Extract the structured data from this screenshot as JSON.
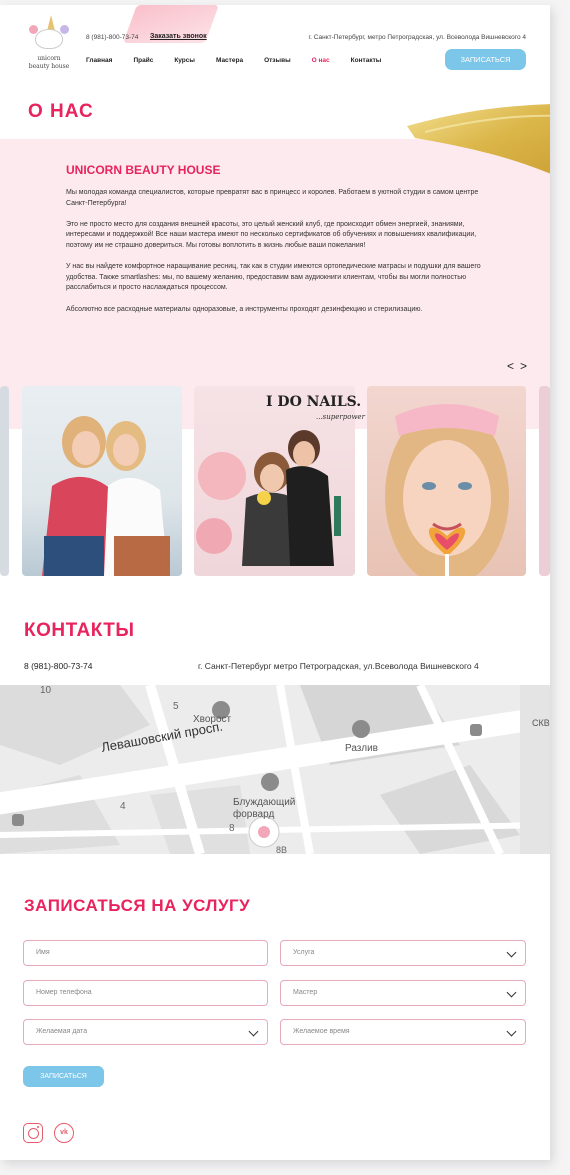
{
  "header": {
    "logo": {
      "line1": "unicorn",
      "line2": "beauty house"
    },
    "phone": "8 (981)-800-73-74",
    "callback_label": "Заказать звонок",
    "address": "г. Санкт-Петербург, метро Петроградская, ул. Всеволода Вишневского 4",
    "nav": [
      {
        "label": "Главная",
        "active": false
      },
      {
        "label": "Прайс",
        "active": false
      },
      {
        "label": "Курсы",
        "active": false
      },
      {
        "label": "Мастера",
        "active": false
      },
      {
        "label": "Отзывы",
        "active": false
      },
      {
        "label": "О нас",
        "active": true
      },
      {
        "label": "Контакты",
        "active": false
      }
    ],
    "book_button": "ЗАПИСАТЬСЯ"
  },
  "about": {
    "title": "О НАС",
    "brand": "UNICORN BEAUTY HOUSE",
    "paragraphs": [
      "Мы молодая команда специалистов, которые превратят вас в принцесс и королев. Работаем в уютной студии в самом центре Санкт-Петербурга!",
      "Это не просто место для создания внешней красоты, это целый женский клуб, где происходит обмен энергией, знаниями, интересами и поддержкой! Все наши мастера имеют по несколько сертификатов об обучениях и повышениях квалификации, поэтому им не страшно довериться. Мы готовы воплотить в жизнь любые ваши пожелания!",
      "У нас вы найдете комфортное наращивание ресниц, так как в студии имеются ортопедические матрасы и подушки для вашего удобства. Также smartlashes: мы, по вашему желанию, предоставим вам аудиокниги клиентам, чтобы вы могли полностью расслабиться и просто наслаждаться процессом.",
      "Абсолютно все расходные материалы одноразовые, а инструменты проходят дезинфекцию и стерилизацию."
    ],
    "prev_arrow": "<",
    "next_arrow": ">",
    "photo_caption": "I DO NAILS.",
    "photo_subcaption": "...superpower"
  },
  "contacts": {
    "title": "КОНТАКТЫ",
    "phone": "8 (981)-800-73-74",
    "address": "г. Санкт-Петербург метро Петроградская, ул.Всеволода Вишневского 4",
    "map": {
      "street": "Левашовский просп.",
      "places": [
        "Хворост",
        "Разлив",
        "Блуждающий форвард"
      ],
      "numbers": [
        "10",
        "5",
        "4",
        "8",
        "8В"
      ],
      "edge_label": "СКВ"
    }
  },
  "booking": {
    "title": "ЗАПИСАТЬСЯ НА УСЛУГУ",
    "fields": {
      "name": "Имя",
      "service": "Услуга",
      "phone": "Номер телефона",
      "master": "Мастер",
      "date": "Желаемая дата",
      "time": "Желаемое время"
    },
    "submit": "ЗАПИСАТЬСЯ"
  },
  "social": {
    "vk": "vk"
  },
  "colors": {
    "accent": "#e8235d",
    "button": "#7cc6ea",
    "band": "#fdeaee",
    "field_border": "#e8aab9"
  }
}
